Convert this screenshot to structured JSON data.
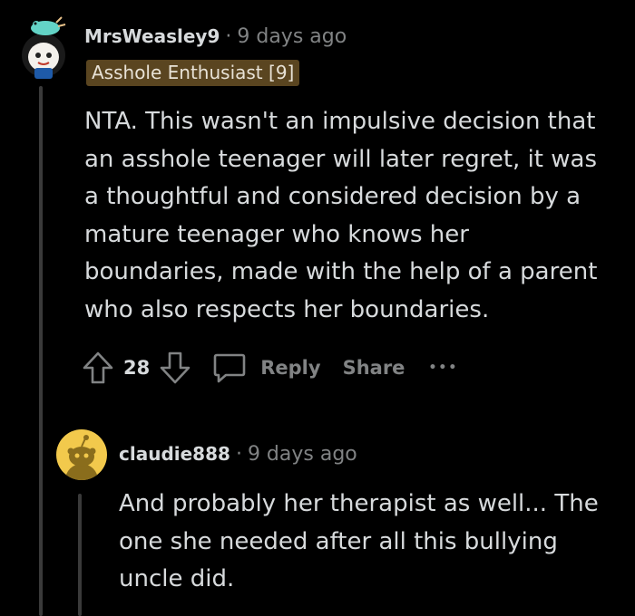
{
  "comments": [
    {
      "username": "MrsWeasley9",
      "separator": "·",
      "time": "9 days ago",
      "flair": "Asshole Enthusiast [9]",
      "body": "NTA. This wasn't an impulsive decision that\nan asshole teenager will later regret, it was\na thoughtful and considered decision by a\nmature teenager who knows her\nboundaries, made with the help of a parent\nwho also respects her boundaries.",
      "vote_count": "28",
      "reply_label": "Reply",
      "share_label": "Share",
      "more_label": "•••"
    },
    {
      "username": "claudie888",
      "separator": "·",
      "time": "9 days ago",
      "body": "And probably her therapist as well... The\none she needed after all this bullying\nuncle did."
    }
  ],
  "colors": {
    "background": "#000000",
    "text": "#d7dadc",
    "muted": "#818384",
    "flair_bg": "#5a4520",
    "thread_line": "#3a3a3a",
    "avatar_yellow": "#f2c94c"
  },
  "icons": [
    "upvote-arrow-icon",
    "downvote-arrow-icon",
    "comment-bubble-icon",
    "snoo-avatar-icon"
  ]
}
